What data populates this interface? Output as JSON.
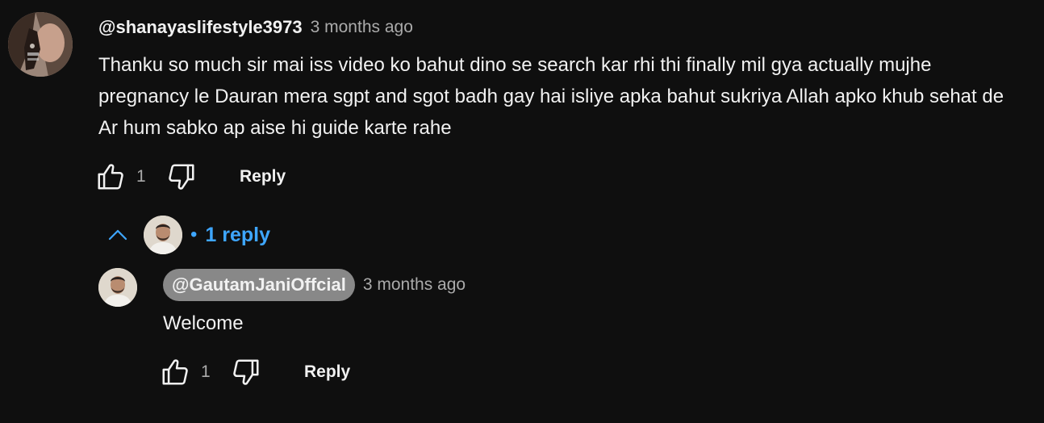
{
  "comment": {
    "author": "@shanayaslifestyle3973",
    "timestamp": "3 months ago",
    "text": "Thanku so much sir mai iss video ko bahut dino se search kar rhi thi finally mil gya actually mujhe pregnancy le Dauran mera sgpt and sgot badh gay hai isliye apka bahut sukriya Allah apko khub sehat de Ar hum sabko ap aise hi guide karte rahe",
    "like_count": "1",
    "reply_label": "Reply"
  },
  "replies_toggle": {
    "dot": "•",
    "label": "1 reply",
    "accent_color": "#3ea6ff"
  },
  "reply": {
    "author": "@GautamJaniOffcial",
    "timestamp": "3 months ago",
    "text": "Welcome",
    "like_count": "1",
    "reply_label": "Reply",
    "creator_chip_color": "#888888"
  },
  "icons": {
    "like": "thumbs-up-icon",
    "dislike": "thumbs-down-icon",
    "collapse": "chevron-up-icon"
  }
}
